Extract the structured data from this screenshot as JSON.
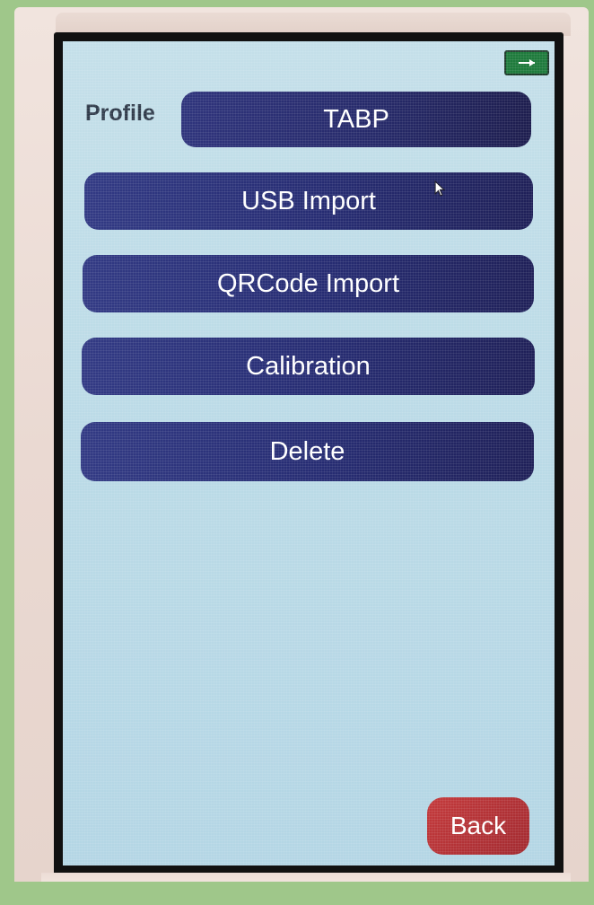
{
  "header": {
    "profile_label": "Profile",
    "profile_value": "TABP",
    "battery_icon": "battery-charging-icon"
  },
  "menu": {
    "items": [
      {
        "label": "USB Import"
      },
      {
        "label": "QRCode Import"
      },
      {
        "label": "Calibration"
      },
      {
        "label": "Delete"
      }
    ]
  },
  "footer": {
    "back_label": "Back"
  },
  "colors": {
    "button": "#2a2f78",
    "back_button": "#b3303a",
    "screen_background": "#bcdbe7",
    "battery": "#1e7a3c"
  }
}
